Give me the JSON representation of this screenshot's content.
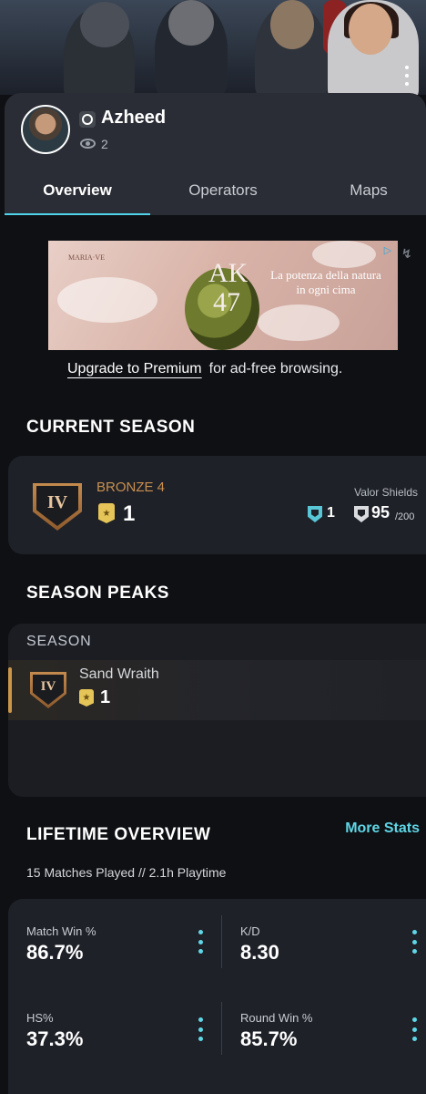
{
  "profile": {
    "username": "Azheed",
    "views": "2"
  },
  "tabs": [
    {
      "label": "Overview",
      "active": true
    },
    {
      "label": "Operators",
      "active": false
    },
    {
      "label": "Maps",
      "active": false
    }
  ],
  "ad": {
    "brand": "MARIA·VE",
    "headline": "AK\n47",
    "tagline": "La potenza della natura in ogni cima",
    "adchoices": "▷",
    "side_icon": "↯"
  },
  "premium": {
    "link_label": "Upgrade to Premium",
    "rest_text": "for ad-free browsing."
  },
  "current_season": {
    "title": "CURRENT SEASON",
    "rank_numeral": "IV",
    "rank_name": "BRONZE 4",
    "level": "1",
    "valor_label": "Valor Shields",
    "shield_count_1": "1",
    "shield_count_2": "95",
    "shield_max": "/200"
  },
  "season_peaks": {
    "title": "SEASON PEAKS",
    "column_header": "SEASON",
    "rows": [
      {
        "rank_numeral": "IV",
        "season_name": "Sand Wraith",
        "level": "1"
      }
    ]
  },
  "lifetime": {
    "title": "LIFETIME OVERVIEW",
    "more_stats": "More Stats",
    "subtitle": "15 Matches Played // 2.1h Playtime",
    "stats": [
      {
        "label": "Match Win %",
        "value": "86.7%"
      },
      {
        "label": "K/D",
        "value": "8.30"
      },
      {
        "label": "HS%",
        "value": "37.3%"
      },
      {
        "label": "Round Win %",
        "value": "85.7%"
      }
    ]
  },
  "colors": {
    "accent": "#5fd6e6",
    "bronze": "#c98f50",
    "background": "#0f1014",
    "card": "#1e2128"
  }
}
